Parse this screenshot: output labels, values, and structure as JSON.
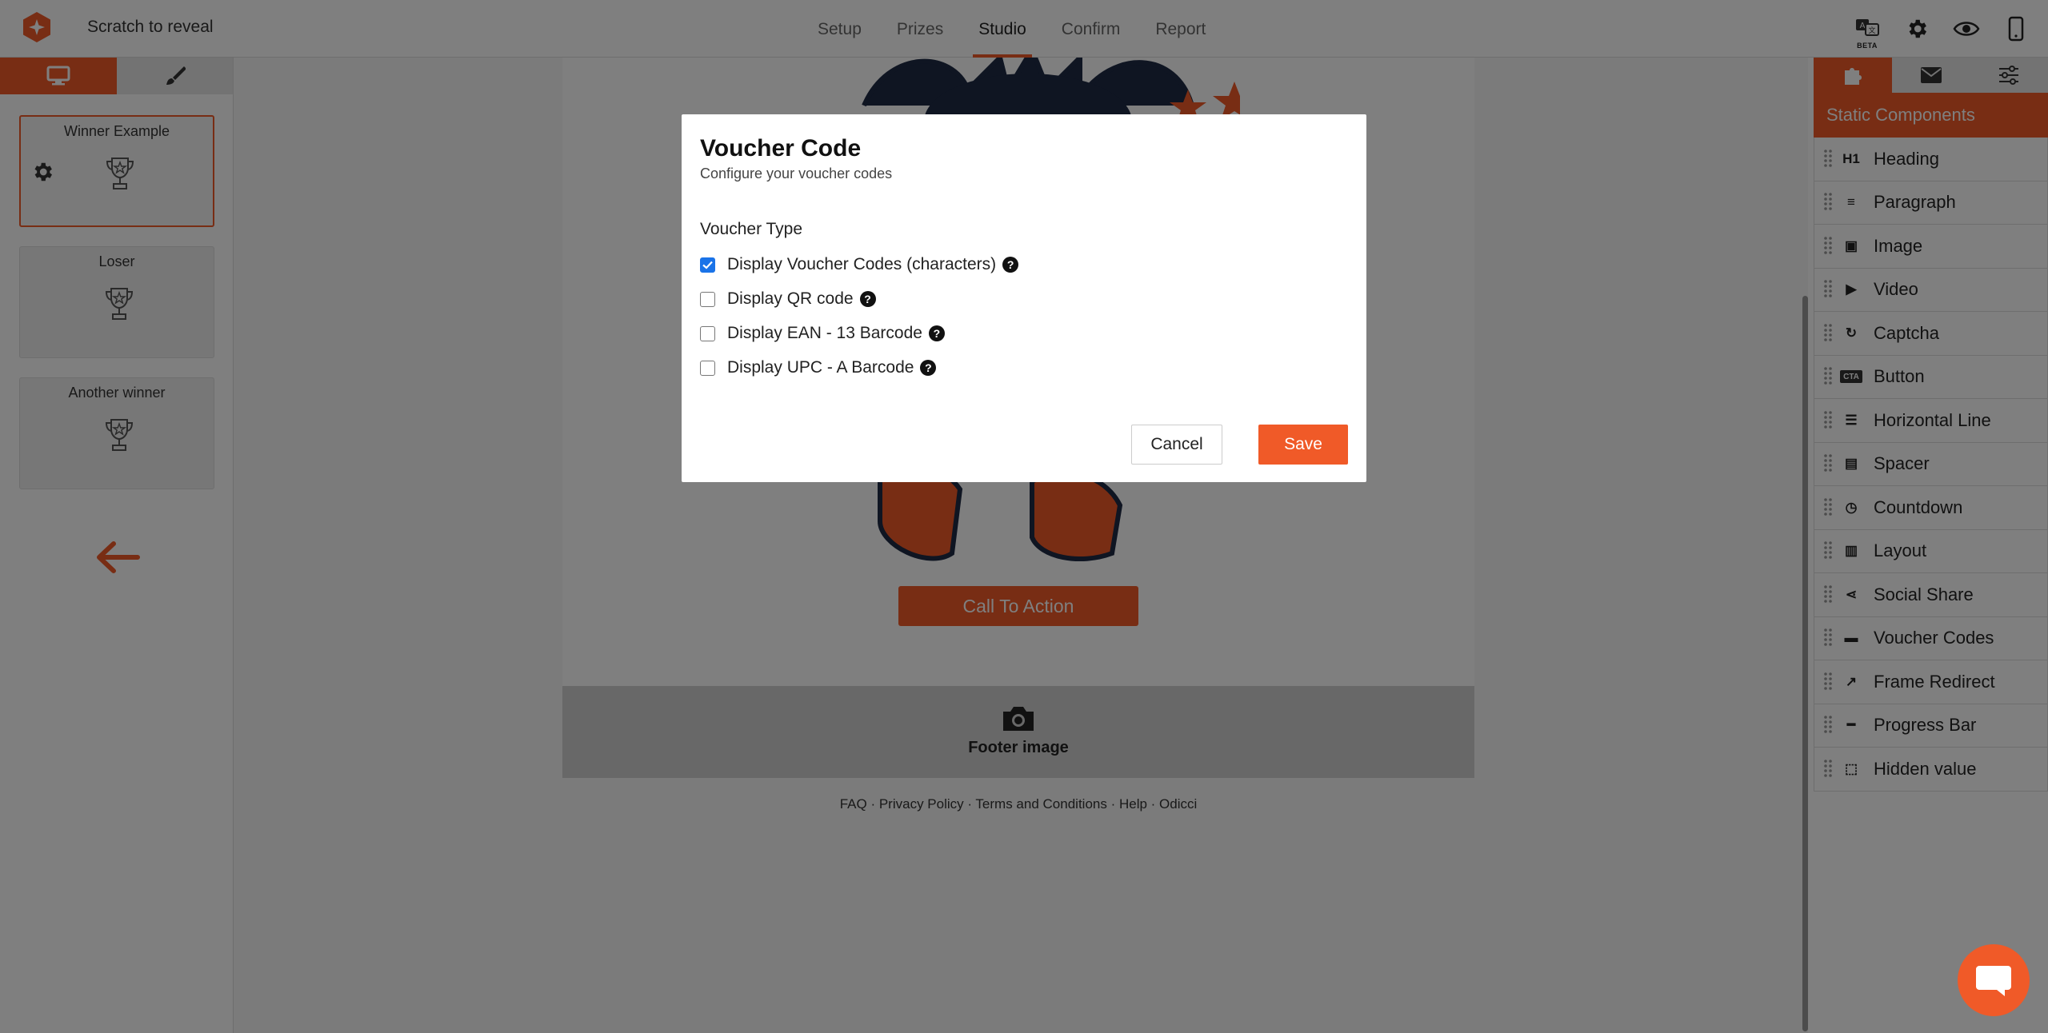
{
  "app": {
    "title": "Scratch to reveal",
    "accent_color": "#f05a28"
  },
  "nav": {
    "tabs": [
      {
        "label": "Setup"
      },
      {
        "label": "Prizes"
      },
      {
        "label": "Studio",
        "active": true
      },
      {
        "label": "Confirm"
      },
      {
        "label": "Report"
      }
    ]
  },
  "top_icons": {
    "beta_label": "BETA",
    "items": [
      "translate-beta-icon",
      "gear-icon",
      "eye-icon",
      "mobile-icon"
    ]
  },
  "left_sidebar": {
    "tabs": [
      "desktop-icon",
      "brush-icon"
    ],
    "cards": [
      {
        "title": "Winner Example",
        "selected": true
      },
      {
        "title": "Loser"
      },
      {
        "title": "Another winner"
      }
    ]
  },
  "canvas": {
    "cta_label": "Call To Action",
    "footer_image_label": "Footer image",
    "footer_links": "FAQ · Privacy Policy · Terms and Conditions · Help · Odicci"
  },
  "right_sidebar": {
    "tabs": [
      "puzzle-icon",
      "envelope-icon",
      "sliders-icon"
    ],
    "header": "Static Components",
    "components": [
      {
        "label": "Heading",
        "icon": "heading-icon"
      },
      {
        "label": "Paragraph",
        "icon": "paragraph-icon"
      },
      {
        "label": "Image",
        "icon": "image-icon"
      },
      {
        "label": "Video",
        "icon": "video-icon"
      },
      {
        "label": "Captcha",
        "icon": "captcha-icon"
      },
      {
        "label": "Button",
        "icon": "button-icon"
      },
      {
        "label": "Horizontal Line",
        "icon": "horizontal-line-icon"
      },
      {
        "label": "Spacer",
        "icon": "spacer-icon"
      },
      {
        "label": "Countdown",
        "icon": "countdown-icon"
      },
      {
        "label": "Layout",
        "icon": "layout-icon"
      },
      {
        "label": "Social Share",
        "icon": "share-icon"
      },
      {
        "label": "Voucher Codes",
        "icon": "voucher-icon"
      },
      {
        "label": "Frame Redirect",
        "icon": "external-link-icon"
      },
      {
        "label": "Progress Bar",
        "icon": "progress-bar-icon"
      },
      {
        "label": "Hidden value",
        "icon": "hidden-value-icon"
      }
    ]
  },
  "modal": {
    "title": "Voucher Code",
    "subtitle": "Configure your voucher codes",
    "section_label": "Voucher Type",
    "options": [
      {
        "label": "Display Voucher Codes (characters)",
        "checked": true
      },
      {
        "label": "Display QR code",
        "checked": false
      },
      {
        "label": "Display EAN - 13 Barcode",
        "checked": false
      },
      {
        "label": "Display UPC - A Barcode",
        "checked": false
      }
    ],
    "cancel_label": "Cancel",
    "save_label": "Save"
  }
}
